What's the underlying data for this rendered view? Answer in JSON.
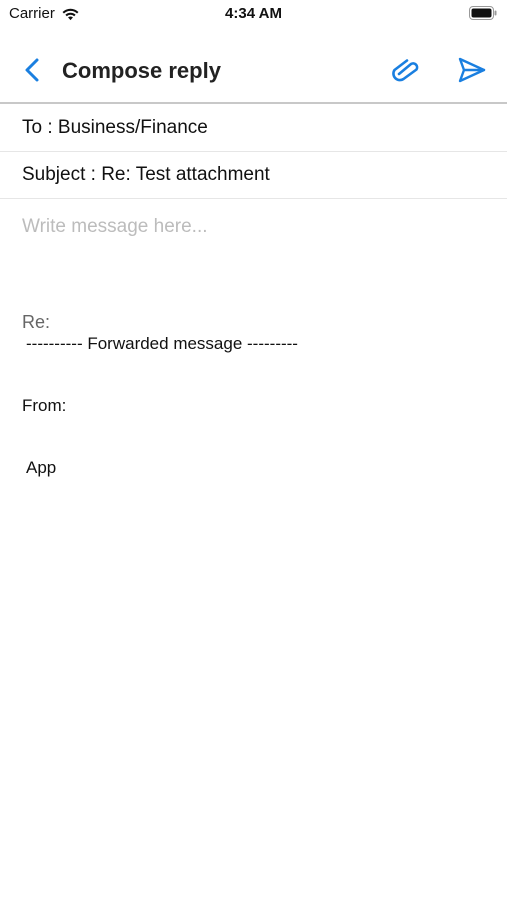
{
  "status_bar": {
    "carrier": "Carrier",
    "time": "4:34 AM",
    "wifi_icon": "wifi-icon",
    "battery_icon": "battery-icon"
  },
  "nav": {
    "title": "Compose reply",
    "back_icon": "chevron-left-icon",
    "attach_icon": "paperclip-icon",
    "send_icon": "send-icon",
    "accent_color": "#1a7fe0"
  },
  "form": {
    "to_label": "To : Business/Finance",
    "subject_label": "Subject : Re: Test attachment",
    "message_placeholder": "Write message here..."
  },
  "quoted": {
    "re": "Re:",
    "forwarded": "---------- Forwarded message ---------",
    "from": "From:",
    "body": "App"
  }
}
